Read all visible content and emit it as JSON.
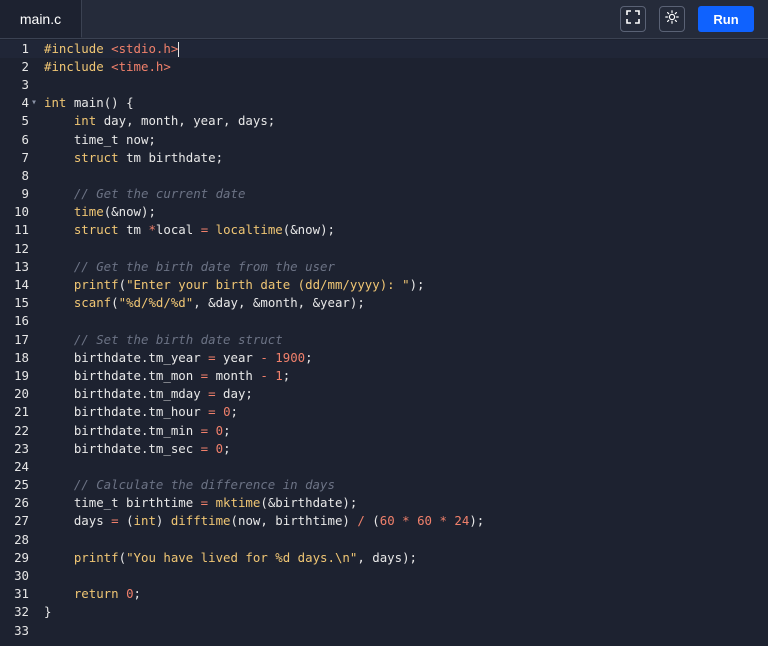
{
  "tab": {
    "label": "main.c"
  },
  "toolbar": {
    "run_label": "Run"
  },
  "icons": {
    "fullscreen": "fullscreen-icon",
    "theme": "sun-icon"
  },
  "colors": {
    "accent": "#0f62fe",
    "background": "#1d2230",
    "keyword": "#f0c674",
    "number": "#f0806b",
    "comment": "#6c7385"
  },
  "editor": {
    "lines": [
      {
        "n": "1",
        "tokens": [
          [
            "pp",
            "#include "
          ],
          [
            "inc",
            "<stdio.h>"
          ]
        ],
        "cursor": true,
        "active": true
      },
      {
        "n": "2",
        "tokens": [
          [
            "pp",
            "#include "
          ],
          [
            "inc",
            "<time.h>"
          ]
        ]
      },
      {
        "n": "3",
        "tokens": []
      },
      {
        "n": "4",
        "fold": true,
        "tokens": [
          [
            "kw",
            "int"
          ],
          [
            "pl",
            " main() {"
          ]
        ]
      },
      {
        "n": "5",
        "tokens": [
          [
            "pl",
            "    "
          ],
          [
            "kw",
            "int"
          ],
          [
            "pl",
            " day, month, year, days;"
          ]
        ]
      },
      {
        "n": "6",
        "tokens": [
          [
            "pl",
            "    time_t now;"
          ]
        ]
      },
      {
        "n": "7",
        "tokens": [
          [
            "pl",
            "    "
          ],
          [
            "kw",
            "struct"
          ],
          [
            "pl",
            " tm birthdate;"
          ]
        ]
      },
      {
        "n": "8",
        "tokens": []
      },
      {
        "n": "9",
        "tokens": [
          [
            "pl",
            "    "
          ],
          [
            "cm",
            "// Get the current date"
          ]
        ]
      },
      {
        "n": "10",
        "tokens": [
          [
            "pl",
            "    "
          ],
          [
            "fn",
            "time"
          ],
          [
            "pl",
            "(&now);"
          ]
        ]
      },
      {
        "n": "11",
        "tokens": [
          [
            "pl",
            "    "
          ],
          [
            "kw",
            "struct"
          ],
          [
            "pl",
            " tm "
          ],
          [
            "op",
            "*"
          ],
          [
            "pl",
            "local "
          ],
          [
            "op",
            "="
          ],
          [
            "pl",
            " "
          ],
          [
            "fn",
            "localtime"
          ],
          [
            "pl",
            "(&now);"
          ]
        ]
      },
      {
        "n": "12",
        "tokens": []
      },
      {
        "n": "13",
        "tokens": [
          [
            "pl",
            "    "
          ],
          [
            "cm",
            "// Get the birth date from the user"
          ]
        ]
      },
      {
        "n": "14",
        "tokens": [
          [
            "pl",
            "    "
          ],
          [
            "fn",
            "printf"
          ],
          [
            "pl",
            "("
          ],
          [
            "str",
            "\"Enter your birth date (dd/mm/yyyy): \""
          ],
          [
            "pl",
            ");"
          ]
        ]
      },
      {
        "n": "15",
        "tokens": [
          [
            "pl",
            "    "
          ],
          [
            "fn",
            "scanf"
          ],
          [
            "pl",
            "("
          ],
          [
            "str",
            "\"%d/%d/%d\""
          ],
          [
            "pl",
            ", &day, &month, &year);"
          ]
        ]
      },
      {
        "n": "16",
        "tokens": []
      },
      {
        "n": "17",
        "tokens": [
          [
            "pl",
            "    "
          ],
          [
            "cm",
            "// Set the birth date struct"
          ]
        ]
      },
      {
        "n": "18",
        "tokens": [
          [
            "pl",
            "    birthdate.tm_year "
          ],
          [
            "op",
            "="
          ],
          [
            "pl",
            " year "
          ],
          [
            "op",
            "-"
          ],
          [
            "pl",
            " "
          ],
          [
            "num",
            "1900"
          ],
          [
            "pl",
            ";"
          ]
        ]
      },
      {
        "n": "19",
        "tokens": [
          [
            "pl",
            "    birthdate.tm_mon "
          ],
          [
            "op",
            "="
          ],
          [
            "pl",
            " month "
          ],
          [
            "op",
            "-"
          ],
          [
            "pl",
            " "
          ],
          [
            "num",
            "1"
          ],
          [
            "pl",
            ";"
          ]
        ]
      },
      {
        "n": "20",
        "tokens": [
          [
            "pl",
            "    birthdate.tm_mday "
          ],
          [
            "op",
            "="
          ],
          [
            "pl",
            " day;"
          ]
        ]
      },
      {
        "n": "21",
        "tokens": [
          [
            "pl",
            "    birthdate.tm_hour "
          ],
          [
            "op",
            "="
          ],
          [
            "pl",
            " "
          ],
          [
            "num",
            "0"
          ],
          [
            "pl",
            ";"
          ]
        ]
      },
      {
        "n": "22",
        "tokens": [
          [
            "pl",
            "    birthdate.tm_min "
          ],
          [
            "op",
            "="
          ],
          [
            "pl",
            " "
          ],
          [
            "num",
            "0"
          ],
          [
            "pl",
            ";"
          ]
        ]
      },
      {
        "n": "23",
        "tokens": [
          [
            "pl",
            "    birthdate.tm_sec "
          ],
          [
            "op",
            "="
          ],
          [
            "pl",
            " "
          ],
          [
            "num",
            "0"
          ],
          [
            "pl",
            ";"
          ]
        ]
      },
      {
        "n": "24",
        "tokens": []
      },
      {
        "n": "25",
        "tokens": [
          [
            "pl",
            "    "
          ],
          [
            "cm",
            "// Calculate the difference in days"
          ]
        ]
      },
      {
        "n": "26",
        "tokens": [
          [
            "pl",
            "    time_t birthtime "
          ],
          [
            "op",
            "="
          ],
          [
            "pl",
            " "
          ],
          [
            "fn",
            "mktime"
          ],
          [
            "pl",
            "(&birthdate);"
          ]
        ]
      },
      {
        "n": "27",
        "tokens": [
          [
            "pl",
            "    days "
          ],
          [
            "op",
            "="
          ],
          [
            "pl",
            " ("
          ],
          [
            "kw",
            "int"
          ],
          [
            "pl",
            ") "
          ],
          [
            "fn",
            "difftime"
          ],
          [
            "pl",
            "(now, birthtime) "
          ],
          [
            "op",
            "/"
          ],
          [
            "pl",
            " ("
          ],
          [
            "num",
            "60"
          ],
          [
            "pl",
            " "
          ],
          [
            "op",
            "*"
          ],
          [
            "pl",
            " "
          ],
          [
            "num",
            "60"
          ],
          [
            "pl",
            " "
          ],
          [
            "op",
            "*"
          ],
          [
            "pl",
            " "
          ],
          [
            "num",
            "24"
          ],
          [
            "pl",
            ");"
          ]
        ]
      },
      {
        "n": "28",
        "tokens": []
      },
      {
        "n": "29",
        "tokens": [
          [
            "pl",
            "    "
          ],
          [
            "fn",
            "printf"
          ],
          [
            "pl",
            "("
          ],
          [
            "str",
            "\"You have lived for %d days.\\n\""
          ],
          [
            "pl",
            ", days);"
          ]
        ]
      },
      {
        "n": "30",
        "tokens": []
      },
      {
        "n": "31",
        "tokens": [
          [
            "pl",
            "    "
          ],
          [
            "kw",
            "return"
          ],
          [
            "pl",
            " "
          ],
          [
            "num",
            "0"
          ],
          [
            "pl",
            ";"
          ]
        ]
      },
      {
        "n": "32",
        "tokens": [
          [
            "pl",
            "}"
          ]
        ]
      },
      {
        "n": "33",
        "tokens": []
      }
    ]
  }
}
